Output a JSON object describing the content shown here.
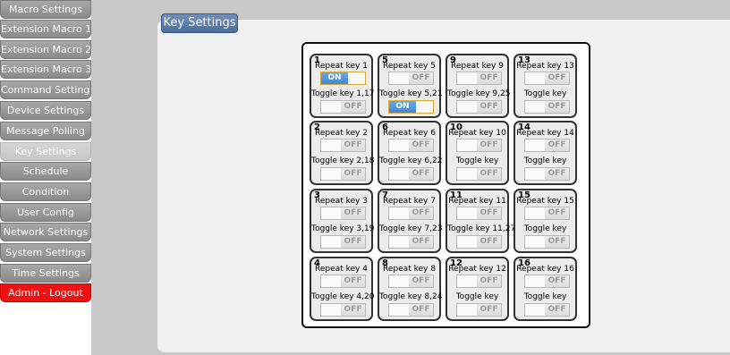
{
  "sidebar": {
    "items": [
      {
        "label": "Macro Settings",
        "active": false
      },
      {
        "label": "Extension Macro 1",
        "active": false
      },
      {
        "label": "Extension Macro 2",
        "active": false
      },
      {
        "label": "Extension Macro 3",
        "active": false
      },
      {
        "label": "Command Settings",
        "active": false
      },
      {
        "label": "Device Settings",
        "active": false
      },
      {
        "label": "Message Polling",
        "active": false
      },
      {
        "label": "Key Settings",
        "active": true
      },
      {
        "label": "Schedule",
        "active": false
      },
      {
        "label": "Condition",
        "active": false
      },
      {
        "label": "User Config",
        "active": false
      },
      {
        "label": "Network Settings",
        "active": false
      },
      {
        "label": "System Settings",
        "active": false
      },
      {
        "label": "Time Settings",
        "active": false
      },
      {
        "label": "Admin - Logout",
        "active": false
      }
    ]
  },
  "panel": {
    "title": "Key Settings"
  },
  "keys": [
    {
      "num": "1",
      "repeat_label": "Repeat key 1",
      "repeat_state": "ON",
      "toggle_label": "Toggle key 1,17",
      "toggle_state": "OFF"
    },
    {
      "num": "2",
      "repeat_label": "Repeat key 2",
      "repeat_state": "OFF",
      "toggle_label": "Toggle key 2,18",
      "toggle_state": "OFF"
    },
    {
      "num": "3",
      "repeat_label": "Repeat key 3",
      "repeat_state": "OFF",
      "toggle_label": "Toggle key 3,19",
      "toggle_state": "OFF"
    },
    {
      "num": "4",
      "repeat_label": "Repeat key 4",
      "repeat_state": "OFF",
      "toggle_label": "Toggle key 4,20",
      "toggle_state": "OFF"
    },
    {
      "num": "5",
      "repeat_label": "Repeat key 5",
      "repeat_state": "OFF",
      "toggle_label": "Toggle key 5,21",
      "toggle_state": "ON"
    },
    {
      "num": "6",
      "repeat_label": "Repeat key 6",
      "repeat_state": "OFF",
      "toggle_label": "Toggle key 6,22",
      "toggle_state": "OFF"
    },
    {
      "num": "7",
      "repeat_label": "Repeat key 7",
      "repeat_state": "OFF",
      "toggle_label": "Toggle key 7,23",
      "toggle_state": "OFF"
    },
    {
      "num": "8",
      "repeat_label": "Repeat key 8",
      "repeat_state": "OFF",
      "toggle_label": "Toggle key 8,24",
      "toggle_state": "OFF"
    },
    {
      "num": "9",
      "repeat_label": "Repeat key 9",
      "repeat_state": "OFF",
      "toggle_label": "Toggle key 9,25",
      "toggle_state": "OFF"
    },
    {
      "num": "10",
      "repeat_label": "Repeat key 10",
      "repeat_state": "OFF",
      "toggle_label": "Toggle key",
      "toggle_state": "OFF"
    },
    {
      "num": "11",
      "repeat_label": "Repeat key 11",
      "repeat_state": "OFF",
      "toggle_label": "Toggle key 11,27",
      "toggle_state": "OFF"
    },
    {
      "num": "12",
      "repeat_label": "Repeat key 12",
      "repeat_state": "OFF",
      "toggle_label": "Toggle key",
      "toggle_state": "OFF"
    },
    {
      "num": "13",
      "repeat_label": "Repeat key 13",
      "repeat_state": "OFF",
      "toggle_label": "Toggle key",
      "toggle_state": "OFF"
    },
    {
      "num": "14",
      "repeat_label": "Repeat key 14",
      "repeat_state": "OFF",
      "toggle_label": "Toggle key",
      "toggle_state": "OFF"
    },
    {
      "num": "15",
      "repeat_label": "Repeat key 15",
      "repeat_state": "OFF",
      "toggle_label": "Toggle key",
      "toggle_state": "OFF"
    },
    {
      "num": "16",
      "repeat_label": "Repeat key 16",
      "repeat_state": "OFF",
      "toggle_label": "Toggle key",
      "toggle_state": "OFF"
    }
  ],
  "colors": {
    "tab_accent": "#4d6e9c",
    "toggle_on": "#3f86d4",
    "logout_red": "#ee1111",
    "sidebar_gray": "#8a8a8a"
  }
}
